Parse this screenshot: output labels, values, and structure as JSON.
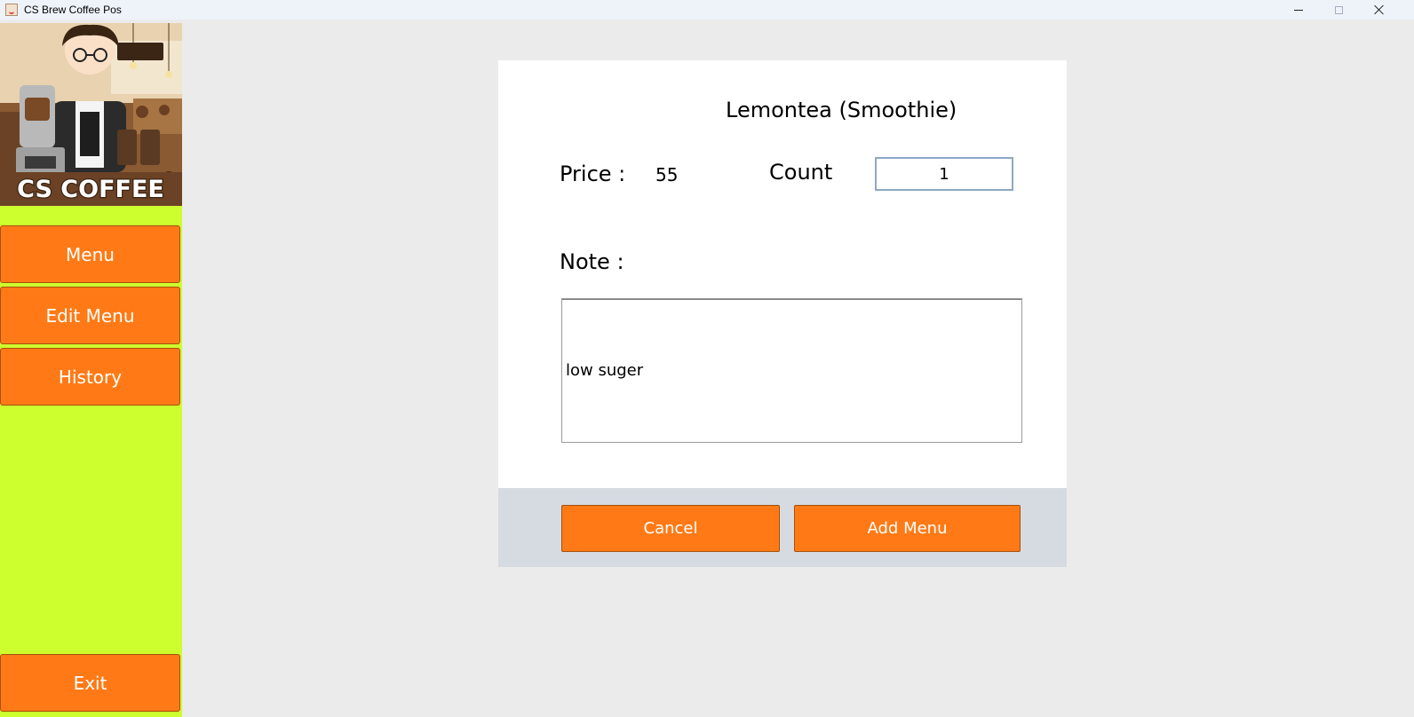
{
  "window": {
    "title": "CS Brew Coffee Pos"
  },
  "sidebar": {
    "logo_text": "CS COFFEE",
    "items": [
      {
        "label": "Menu"
      },
      {
        "label": "Edit Menu"
      },
      {
        "label": "History"
      }
    ],
    "exit_label": "Exit"
  },
  "dialog": {
    "item_name": "Lemontea (Smoothie)",
    "price_label": "Price :",
    "price_value": "55",
    "count_label": "Count",
    "count_value": "1",
    "note_label": "Note :",
    "note_value": "low suger",
    "cancel_label": "Cancel",
    "add_label": "Add Menu"
  },
  "colors": {
    "sidebar_bg": "#cdff2e",
    "button_orange": "#ff7a16",
    "footer_bg": "#d6dbe2",
    "content_bg": "#ebebeb"
  }
}
